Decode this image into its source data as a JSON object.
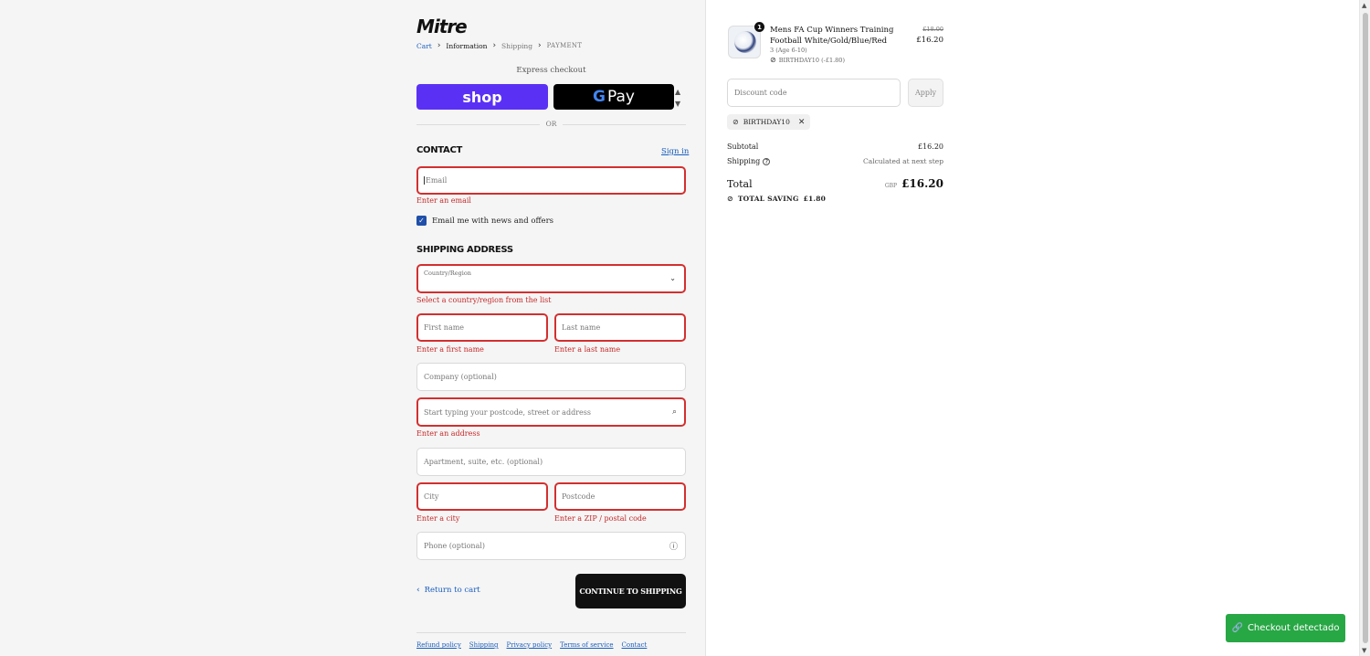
{
  "brand": {
    "logo_text": "Mitre"
  },
  "breadcrumb": {
    "cart": "Cart",
    "information": "Information",
    "shipping": "Shipping",
    "payment": "PAYMENT"
  },
  "express": {
    "label": "Express checkout",
    "shop_pay": "shop",
    "google_pay_g": "G",
    "google_pay": "Pay",
    "or": "OR"
  },
  "contact": {
    "title": "CONTACT",
    "sign_in": "Sign in",
    "email_placeholder": "Email",
    "email_error": "Enter an email",
    "newsletter_label": "Email me with news and offers",
    "newsletter_checked": true
  },
  "shipping_address": {
    "title": "SHIPPING ADDRESS",
    "country_label": "Country/Region",
    "country_value": "",
    "country_error": "Select a country/region from the list",
    "first_name_placeholder": "First name",
    "first_name_error": "Enter a first name",
    "last_name_placeholder": "Last name",
    "last_name_error": "Enter a last name",
    "company_placeholder": "Company (optional)",
    "address_placeholder": "Start typing your postcode, street or address",
    "address_error": "Enter an address",
    "apartment_placeholder": "Apartment, suite, etc. (optional)",
    "city_placeholder": "City",
    "city_error": "Enter a city",
    "postcode_placeholder": "Postcode",
    "postcode_error": "Enter a ZIP / postal code",
    "phone_placeholder": "Phone (optional)"
  },
  "actions": {
    "return_to_cart": "Return to cart",
    "continue": "CONTINUE TO SHIPPING"
  },
  "footer": {
    "links": [
      "Refund policy",
      "Shipping",
      "Privacy policy",
      "Terms of service",
      "Contact"
    ]
  },
  "order": {
    "item": {
      "quantity": "1",
      "name": "Mens FA Cup Winners Training Football White/Gold/Blue/Red",
      "variant": "3 (Age 6-10)",
      "discount": "BIRTHDAY10 (-£1.80)",
      "original_price": "£18.00",
      "price": "£16.20"
    },
    "discount_placeholder": "Discount code",
    "apply_label": "Apply",
    "applied_code": "BIRTHDAY10",
    "subtotal_label": "Subtotal",
    "subtotal_value": "£16.20",
    "shipping_label": "Shipping",
    "shipping_value": "Calculated at next step",
    "total_label": "Total",
    "total_currency": "GBP",
    "total_value": "£16.20",
    "saving_label": "TOTAL SAVING",
    "saving_value": "£1.80"
  },
  "extension": {
    "detected_label": "Checkout detectado"
  },
  "colors": {
    "error": "#d32f2f",
    "link": "#1a5ebd",
    "shop_pay": "#5a31f4",
    "detected": "#28a745"
  }
}
